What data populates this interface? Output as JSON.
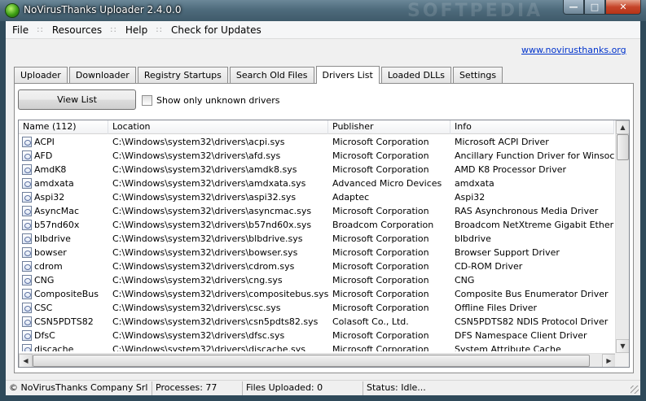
{
  "window": {
    "title": "NoVirusThanks Uploader 2.4.0.0",
    "watermark": "SOFTPEDIA"
  },
  "menu": [
    {
      "label": "File"
    },
    {
      "label": "Resources"
    },
    {
      "label": "Help"
    },
    {
      "label": "Check for Updates"
    }
  ],
  "menu_separator": "::",
  "site_link": "www.novirusthanks.org",
  "tabs": [
    {
      "label": "Uploader"
    },
    {
      "label": "Downloader"
    },
    {
      "label": "Registry Startups"
    },
    {
      "label": "Search Old Files"
    },
    {
      "label": "Drivers List",
      "active": true
    },
    {
      "label": "Loaded DLLs"
    },
    {
      "label": "Settings"
    }
  ],
  "toolbar": {
    "view_list_label": "View List",
    "only_unknown_label": "Show only unknown drivers",
    "only_unknown_checked": false
  },
  "list": {
    "columns": [
      "Name (112)",
      "Location",
      "Publisher",
      "Info"
    ],
    "rows": [
      {
        "name": "ACPI",
        "location": "C:\\Windows\\system32\\drivers\\acpi.sys",
        "publisher": "Microsoft Corporation",
        "info": "Microsoft ACPI Driver"
      },
      {
        "name": "AFD",
        "location": "C:\\Windows\\system32\\drivers\\afd.sys",
        "publisher": "Microsoft Corporation",
        "info": "Ancillary Function Driver for Winsock"
      },
      {
        "name": "AmdK8",
        "location": "C:\\Windows\\system32\\drivers\\amdk8.sys",
        "publisher": "Microsoft Corporation",
        "info": "AMD K8 Processor Driver"
      },
      {
        "name": "amdxata",
        "location": "C:\\Windows\\system32\\drivers\\amdxata.sys",
        "publisher": "Advanced Micro Devices",
        "info": "amdxata"
      },
      {
        "name": "Aspi32",
        "location": "C:\\Windows\\system32\\drivers\\aspi32.sys",
        "publisher": "Adaptec",
        "info": "Aspi32"
      },
      {
        "name": "AsyncMac",
        "location": "C:\\Windows\\system32\\drivers\\asyncmac.sys",
        "publisher": "Microsoft Corporation",
        "info": "RAS Asynchronous Media Driver"
      },
      {
        "name": "b57nd60x",
        "location": "C:\\Windows\\system32\\drivers\\b57nd60x.sys",
        "publisher": "Broadcom Corporation",
        "info": "Broadcom NetXtreme Gigabit Ethernet - ."
      },
      {
        "name": "blbdrive",
        "location": "C:\\Windows\\system32\\drivers\\blbdrive.sys",
        "publisher": "Microsoft Corporation",
        "info": "blbdrive"
      },
      {
        "name": "bowser",
        "location": "C:\\Windows\\system32\\drivers\\bowser.sys",
        "publisher": "Microsoft Corporation",
        "info": "Browser Support Driver"
      },
      {
        "name": "cdrom",
        "location": "C:\\Windows\\system32\\drivers\\cdrom.sys",
        "publisher": "Microsoft Corporation",
        "info": "CD-ROM Driver"
      },
      {
        "name": "CNG",
        "location": "C:\\Windows\\system32\\drivers\\cng.sys",
        "publisher": "Microsoft Corporation",
        "info": "CNG"
      },
      {
        "name": "CompositeBus",
        "location": "C:\\Windows\\system32\\drivers\\compositebus.sys",
        "publisher": "Microsoft Corporation",
        "info": "Composite Bus Enumerator Driver"
      },
      {
        "name": "CSC",
        "location": "C:\\Windows\\system32\\drivers\\csc.sys",
        "publisher": "Microsoft Corporation",
        "info": "Offline Files Driver"
      },
      {
        "name": "CSN5PDTS82",
        "location": "C:\\Windows\\system32\\drivers\\csn5pdts82.sys",
        "publisher": "Colasoft Co., Ltd.",
        "info": "CSN5PDTS82 NDIS Protocol Driver"
      },
      {
        "name": "DfsC",
        "location": "C:\\Windows\\system32\\drivers\\dfsc.sys",
        "publisher": "Microsoft Corporation",
        "info": "DFS Namespace Client Driver"
      },
      {
        "name": "discache",
        "location": "C:\\Windows\\system32\\drivers\\discache.sys",
        "publisher": "Microsoft Corporation",
        "info": "System Attribute Cache"
      }
    ]
  },
  "status": {
    "copyright": "© NoVirusThanks Company Srl",
    "processes": "Processes:  77",
    "files_uploaded": "Files Uploaded:  0",
    "status": "Status: Idle..."
  },
  "icons": {
    "app": "app-icon",
    "driver": "driver-file-icon"
  }
}
